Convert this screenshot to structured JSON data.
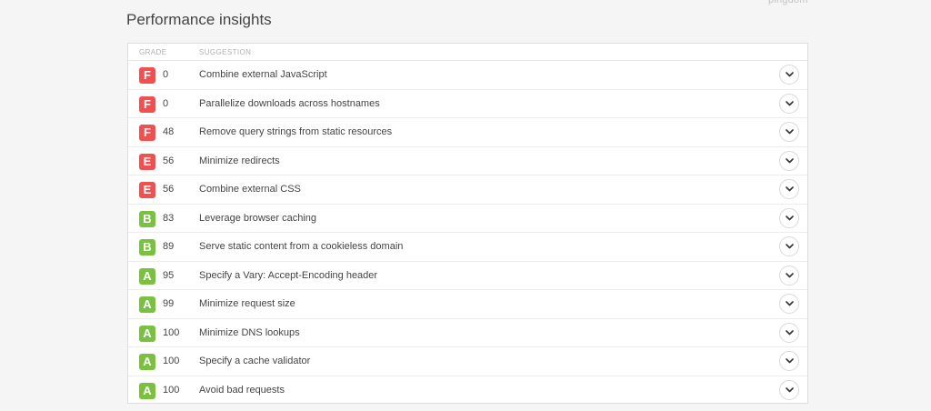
{
  "brand": "pingdom",
  "title": "Performance insights",
  "table": {
    "header_grade": "GRADE",
    "header_suggestion": "SUGGESTION"
  },
  "colors": {
    "grade_F": "#f05050",
    "grade_E": "#f05050",
    "grade_B": "#7ac142",
    "grade_A": "#7ac142"
  },
  "rows": [
    {
      "grade": "F",
      "score": "0",
      "suggestion": "Combine external JavaScript",
      "icon": "chevron-down-icon"
    },
    {
      "grade": "F",
      "score": "0",
      "suggestion": "Parallelize downloads across hostnames",
      "icon": "chevron-down-icon"
    },
    {
      "grade": "F",
      "score": "48",
      "suggestion": "Remove query strings from static resources",
      "icon": "chevron-down-icon"
    },
    {
      "grade": "E",
      "score": "56",
      "suggestion": "Minimize redirects",
      "icon": "chevron-down-icon"
    },
    {
      "grade": "E",
      "score": "56",
      "suggestion": "Combine external CSS",
      "icon": "chevron-down-icon"
    },
    {
      "grade": "B",
      "score": "83",
      "suggestion": "Leverage browser caching",
      "icon": "chevron-down-icon"
    },
    {
      "grade": "B",
      "score": "89",
      "suggestion": "Serve static content from a cookieless domain",
      "icon": "chevron-down-icon"
    },
    {
      "grade": "A",
      "score": "95",
      "suggestion": "Specify a Vary: Accept-Encoding header",
      "icon": "chevron-down-icon"
    },
    {
      "grade": "A",
      "score": "99",
      "suggestion": "Minimize request size",
      "icon": "chevron-down-icon"
    },
    {
      "grade": "A",
      "score": "100",
      "suggestion": "Minimize DNS lookups",
      "icon": "chevron-down-icon"
    },
    {
      "grade": "A",
      "score": "100",
      "suggestion": "Specify a cache validator",
      "icon": "chevron-down-icon"
    },
    {
      "grade": "A",
      "score": "100",
      "suggestion": "Avoid bad requests",
      "icon": "chevron-down-icon"
    }
  ]
}
